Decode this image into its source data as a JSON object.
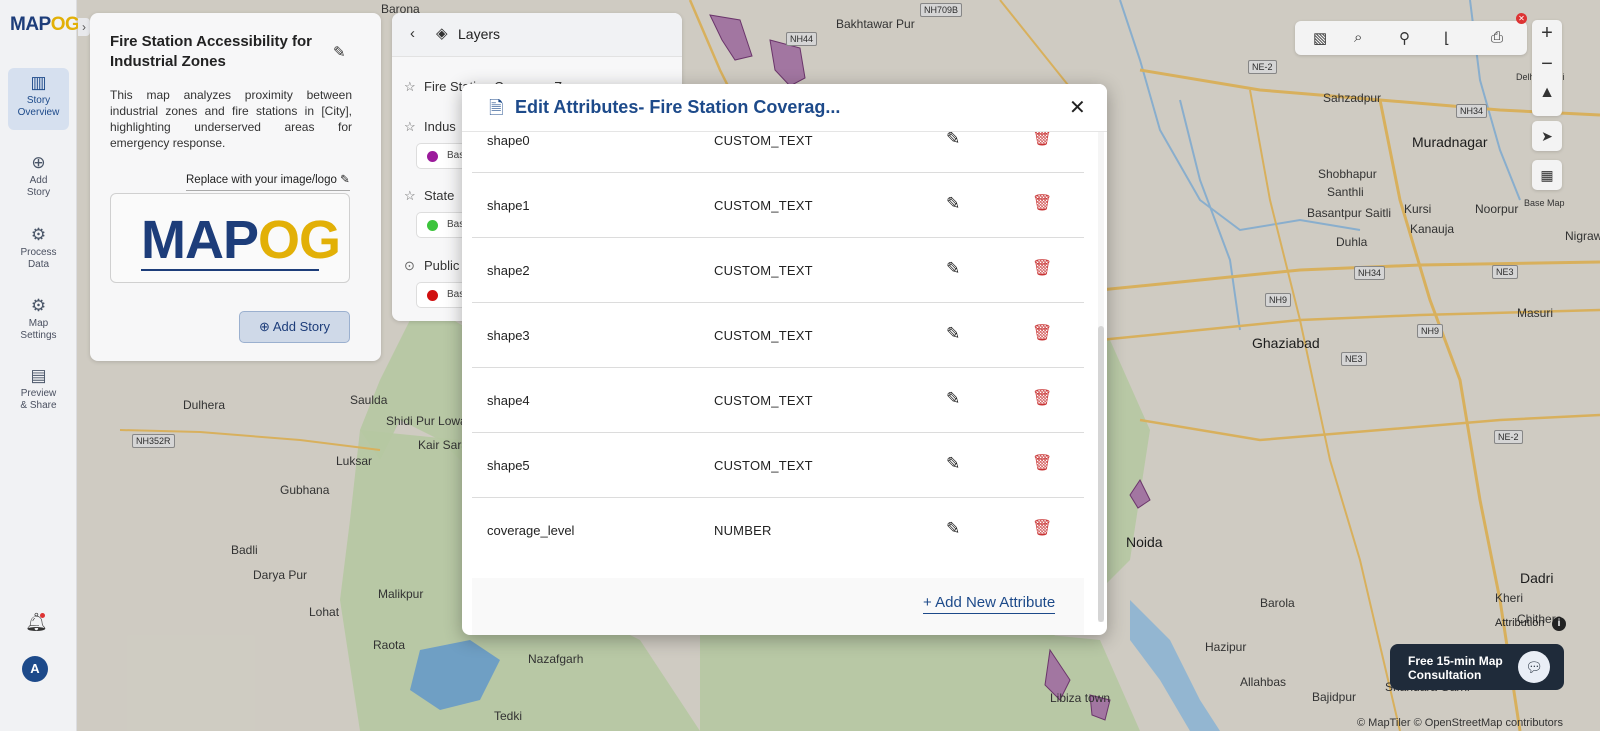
{
  "app": {
    "logo": "MAP",
    "logo_accent": "OG"
  },
  "rail": {
    "items": [
      {
        "label_1": "Story",
        "label_2": "Overview",
        "icon": "map-icon"
      },
      {
        "label_1": "Add",
        "label_2": "Story",
        "icon": "add-location-icon"
      },
      {
        "label_1": "Process",
        "label_2": "Data",
        "icon": "gear-icon"
      },
      {
        "label_1": "Map",
        "label_2": "Settings",
        "icon": "settings-icon"
      },
      {
        "label_1": "Preview",
        "label_2": "& Share",
        "icon": "preview-icon"
      }
    ],
    "avatar": "A"
  },
  "story": {
    "title": "Fire Station Accessibility for Industrial Zones",
    "description": "This map analyzes proximity between industrial zones and fire stations in [City], highlighting underserved areas for emergency response.",
    "replace_logo": "Replace with your image/logo",
    "logo_main": "MAP",
    "logo_accent": "OG",
    "add_story": "Add Story"
  },
  "layers": {
    "title": "Layers",
    "rows": [
      {
        "label": "Fire Station Coverage Zone",
        "sub": "Bas",
        "color": "#9b1a9b"
      },
      {
        "label": "Indus",
        "sub": "Bas",
        "color": "#9b1a9b"
      },
      {
        "label": "State",
        "sub": "Bas",
        "color": "#3cc43c"
      },
      {
        "label": "Public",
        "sub": "Bas",
        "color": "#d01010"
      }
    ]
  },
  "map": {
    "labels": [
      "Barona",
      "Bakhtawar Pur",
      "Sahzadpur",
      "Muradnagar",
      "Shobhapur",
      "Santhli",
      "Kursi",
      "Noorpur",
      "Basantpur Saitli",
      "Kanauja",
      "Duhla",
      "Nigraw",
      "Masuri",
      "Ghaziabad",
      "Dulhera",
      "Saulda",
      "Shidi Pur Lowa",
      "Kair Sarai",
      "Luksar",
      "Gubhana",
      "Badli",
      "Darya Pur",
      "Malikpur",
      "Lohat",
      "Raota",
      "Nazafgarh",
      "Tedki",
      "Noida",
      "Libiza town",
      "Kheri",
      "Dadri",
      "Barola",
      "Hazipur",
      "Chithera",
      "Allahbas",
      "Bajidpur",
      "Shahdara Garhi",
      "Delhi Rohini"
    ],
    "shields": [
      "NH709B",
      "NH44",
      "NE-2",
      "NH34",
      "NH34",
      "NH9",
      "NE3",
      "NH9",
      "NE3",
      "NE-2",
      "NH352R"
    ],
    "attribution": "Attribution",
    "copyright": "© MapTiler © OpenStreetMap contributors",
    "base_map": "Base Map"
  },
  "consult": {
    "text": "Free 15-min Map Consultation"
  },
  "modal": {
    "title": "Edit Attributes- Fire Station Coverag...",
    "attributes": [
      {
        "name": "shape0",
        "type": "CUSTOM_TEXT"
      },
      {
        "name": "shape1",
        "type": "CUSTOM_TEXT"
      },
      {
        "name": "shape2",
        "type": "CUSTOM_TEXT"
      },
      {
        "name": "shape3",
        "type": "CUSTOM_TEXT"
      },
      {
        "name": "shape4",
        "type": "CUSTOM_TEXT"
      },
      {
        "name": "shape5",
        "type": "CUSTOM_TEXT"
      },
      {
        "name": "coverage_level",
        "type": "NUMBER"
      }
    ],
    "add_attribute": "+ Add New Attribute"
  }
}
